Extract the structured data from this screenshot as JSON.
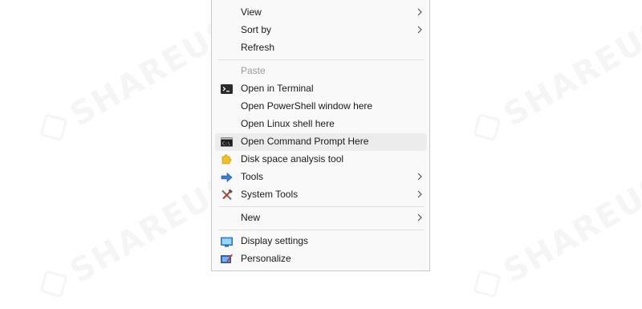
{
  "watermark": {
    "text": "SHAREUS"
  },
  "menu": {
    "items": [
      {
        "label": "View",
        "submenu": true
      },
      {
        "label": "Sort by",
        "submenu": true
      },
      {
        "label": "Refresh"
      },
      {
        "label": "Paste",
        "disabled": true
      },
      {
        "label": "Open in Terminal",
        "icon": "terminal-icon"
      },
      {
        "label": "Open PowerShell window here"
      },
      {
        "label": "Open Linux shell here"
      },
      {
        "label": "Open Command Prompt Here",
        "icon": "command-prompt-icon",
        "highlighted": true
      },
      {
        "label": "Disk space analysis tool",
        "icon": "puzzle-icon"
      },
      {
        "label": "Tools",
        "icon": "tools-arrow-icon",
        "submenu": true
      },
      {
        "label": "System Tools",
        "icon": "wrench-hammer-icon",
        "submenu": true
      },
      {
        "label": "New",
        "submenu": true
      },
      {
        "label": "Display settings",
        "icon": "display-icon"
      },
      {
        "label": "Personalize",
        "icon": "personalize-icon"
      }
    ]
  },
  "colors": {
    "menu_background": "#f9f9f9",
    "highlight": "#ececec",
    "disabled_text": "#9a9a9a"
  }
}
